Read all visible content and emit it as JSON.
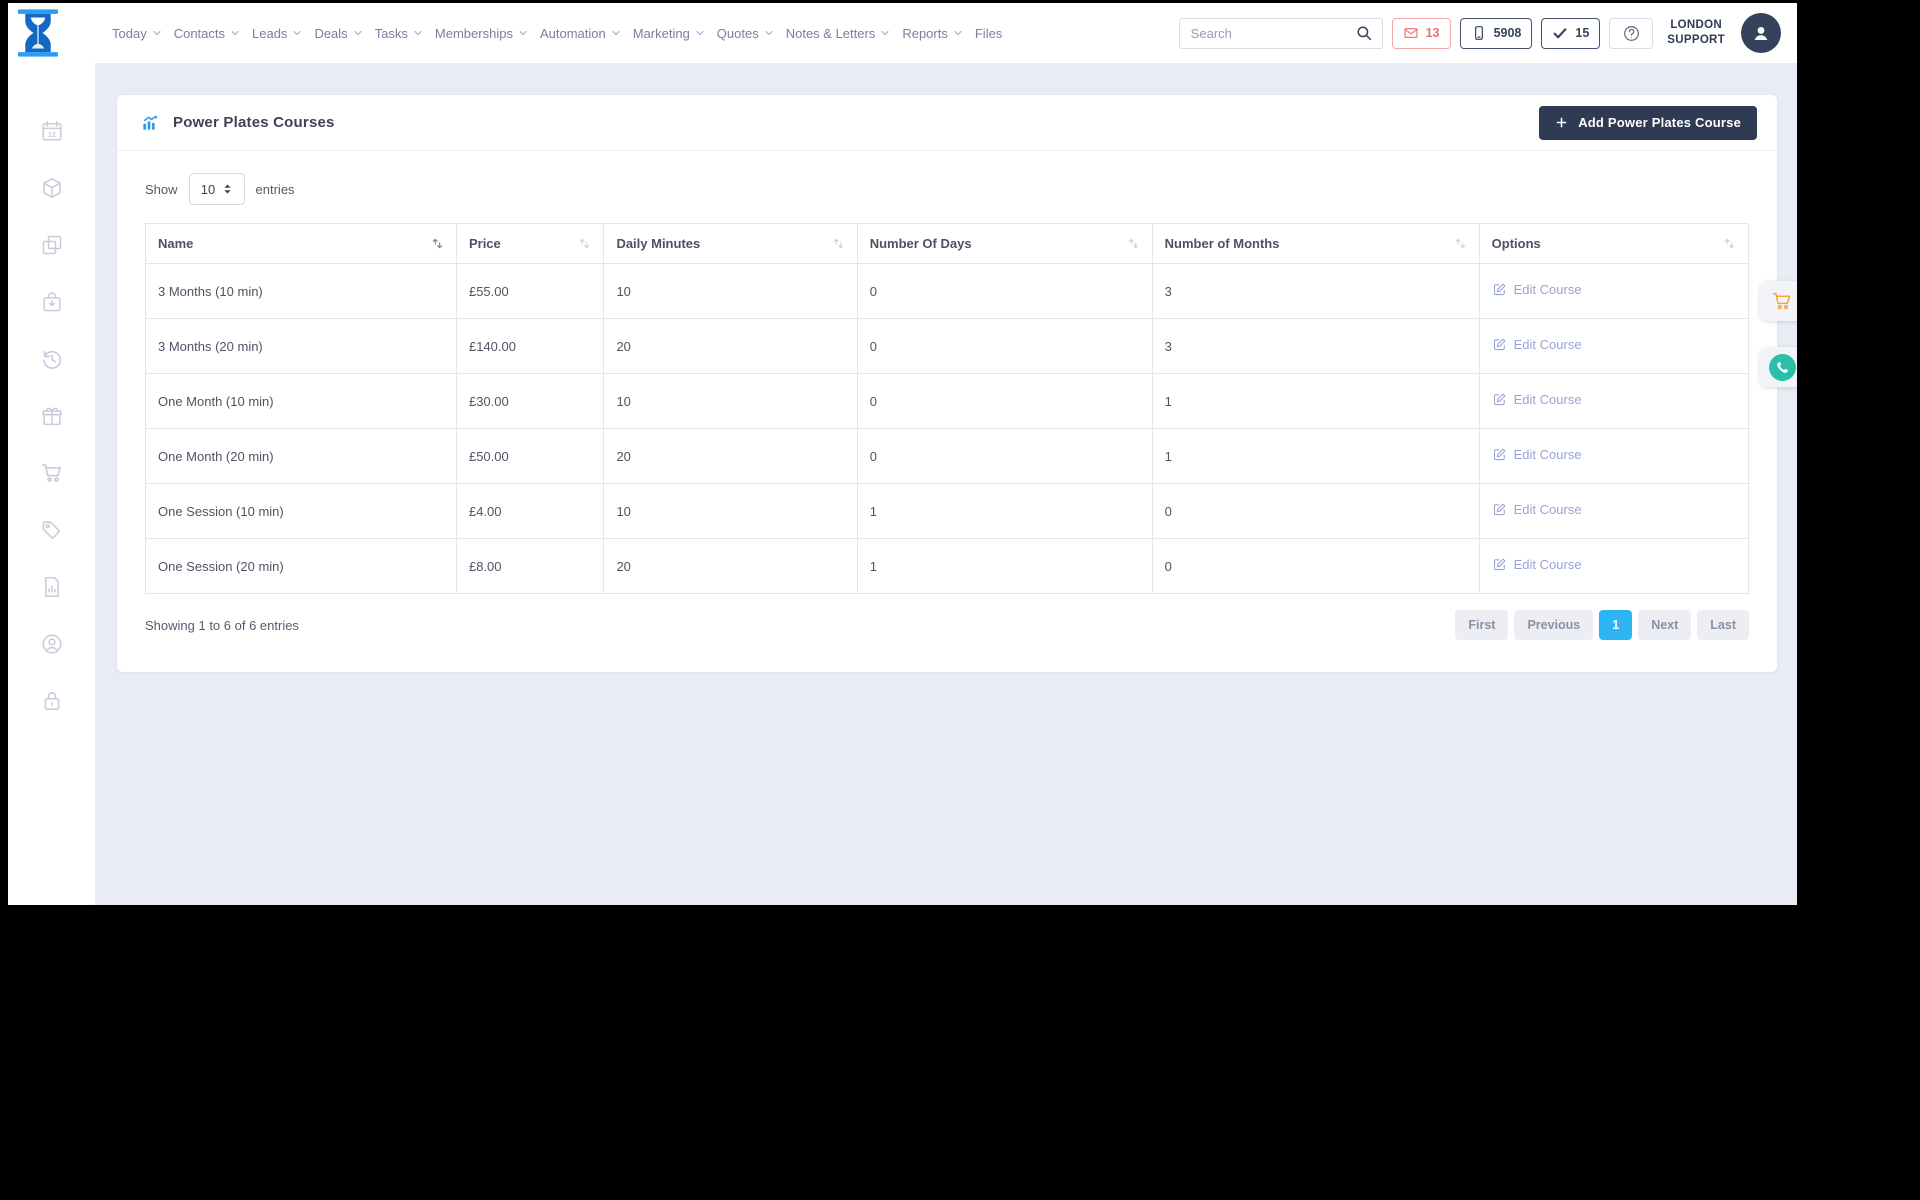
{
  "colors": {
    "accent_blue": "#2cb5f2",
    "navy": "#2e3b52",
    "danger_red": "#e8716f",
    "link": "#9aa3d4",
    "title_icon_blue": "#2b9cf2",
    "floating_cart_orange": "#f6a63a",
    "floating_phone_teal": "#29c0a7"
  },
  "header": {
    "nav": [
      {
        "label": "Today",
        "caret": true
      },
      {
        "label": "Contacts",
        "caret": true
      },
      {
        "label": "Leads",
        "caret": true
      },
      {
        "label": "Deals",
        "caret": true
      },
      {
        "label": "Tasks",
        "caret": true
      },
      {
        "label": "Memberships",
        "caret": true
      },
      {
        "label": "Automation",
        "caret": true
      },
      {
        "label": "Marketing",
        "caret": true
      },
      {
        "label": "Quotes",
        "caret": true
      },
      {
        "label": "Notes & Letters",
        "caret": true
      },
      {
        "label": "Reports",
        "caret": true
      },
      {
        "label": "Files",
        "caret": false
      }
    ],
    "search": {
      "placeholder": "Search"
    },
    "badges": [
      {
        "name": "mail",
        "icon": "envelope-icon",
        "count": "13",
        "style": "danger"
      },
      {
        "name": "mobile",
        "icon": "mobile-icon",
        "count": "5908",
        "style": "dark"
      },
      {
        "name": "tasks",
        "icon": "check-icon",
        "count": "15",
        "style": "dark"
      }
    ],
    "help": {
      "icon": "circle-question-icon"
    },
    "account": {
      "line1": "LONDON",
      "line2": "SUPPORT"
    }
  },
  "sidebar": {
    "items": [
      {
        "icon": "calendar"
      },
      {
        "icon": "package"
      },
      {
        "icon": "duplicate"
      },
      {
        "icon": "bag"
      },
      {
        "icon": "history"
      },
      {
        "icon": "gift"
      },
      {
        "icon": "cart"
      },
      {
        "icon": "tag"
      },
      {
        "icon": "report"
      },
      {
        "icon": "account"
      },
      {
        "icon": "lock"
      }
    ]
  },
  "page": {
    "title": "Power Plates Courses",
    "add_button_label": "Add Power Plates Course",
    "length_control": {
      "show_label": "Show",
      "value": "10",
      "entries_label": "entries"
    },
    "table": {
      "columns": [
        {
          "label": "Name",
          "width": "19.4%",
          "sort_active": true
        },
        {
          "label": "Price",
          "width": "9.2%",
          "sort_active": false
        },
        {
          "label": "Daily Minutes",
          "width": "15.8%",
          "sort_active": false
        },
        {
          "label": "Number Of Days",
          "width": "18.4%",
          "sort_active": false
        },
        {
          "label": "Number of Months",
          "width": "20.4%",
          "sort_active": false
        },
        {
          "label": "Options",
          "width": "16.8%",
          "sort_active": false
        }
      ],
      "rows": [
        {
          "name": "3 Months (10 min)",
          "price": "£55.00",
          "daily_minutes": "10",
          "number_of_days": "0",
          "number_of_months": "3"
        },
        {
          "name": "3 Months (20 min)",
          "price": "£140.00",
          "daily_minutes": "20",
          "number_of_days": "0",
          "number_of_months": "3"
        },
        {
          "name": "One Month (10 min)",
          "price": "£30.00",
          "daily_minutes": "10",
          "number_of_days": "0",
          "number_of_months": "1"
        },
        {
          "name": "One Month (20 min)",
          "price": "£50.00",
          "daily_minutes": "20",
          "number_of_days": "0",
          "number_of_months": "1"
        },
        {
          "name": "One Session (10 min)",
          "price": "£4.00",
          "daily_minutes": "10",
          "number_of_days": "1",
          "number_of_months": "0"
        },
        {
          "name": "One Session (20 min)",
          "price": "£8.00",
          "daily_minutes": "20",
          "number_of_days": "1",
          "number_of_months": "0"
        }
      ],
      "edit_link_label": "Edit Course"
    },
    "footer": {
      "summary": "Showing 1 to 6 of 6 entries",
      "pagination": [
        {
          "label": "First",
          "active": false
        },
        {
          "label": "Previous",
          "active": false
        },
        {
          "label": "1",
          "active": true
        },
        {
          "label": "Next",
          "active": false
        },
        {
          "label": "Last",
          "active": false
        }
      ]
    }
  },
  "floating_buttons": [
    {
      "icon": "cart"
    },
    {
      "icon": "phone"
    }
  ]
}
